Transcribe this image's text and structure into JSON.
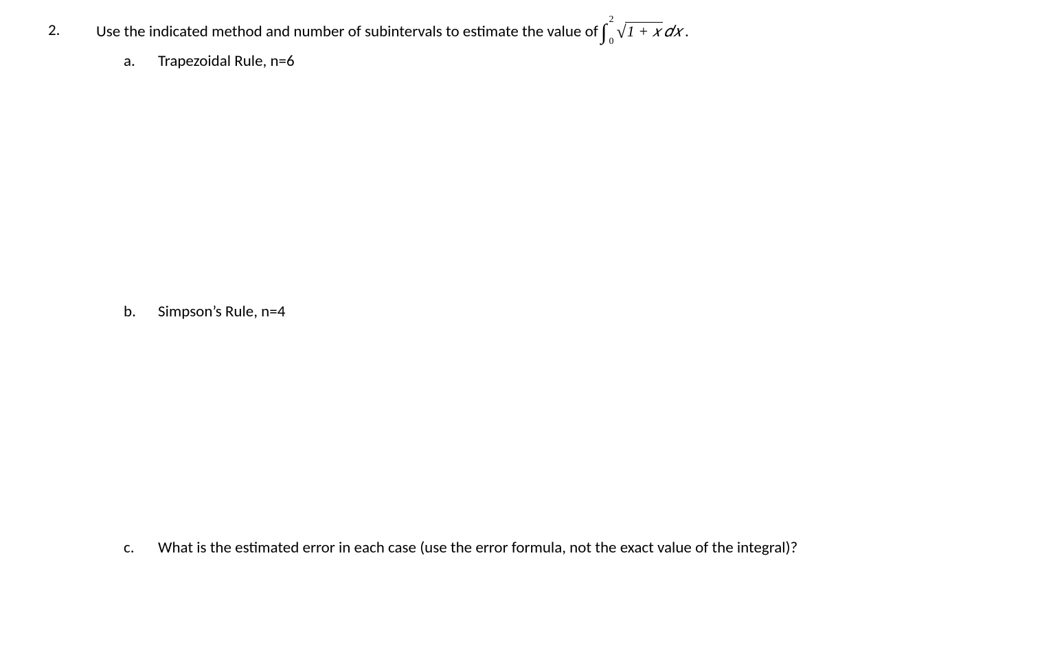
{
  "problem": {
    "number": "2.",
    "statement_prefix": "Use the indicated method and number of subintervals to estimate the value of ",
    "integral": {
      "lower": "0",
      "upper": "2",
      "radicand": "1 + 𝑥",
      "dx": "𝑑𝑥"
    },
    "statement_suffix": ".",
    "subparts": [
      {
        "label": "a.",
        "text": "Trapezoidal Rule, n=6"
      },
      {
        "label": "b.",
        "text": "Simpson’s Rule, n=4"
      },
      {
        "label": "c.",
        "text": "What is the estimated error in each case (use the error formula, not the exact value of the integral)?"
      }
    ]
  }
}
